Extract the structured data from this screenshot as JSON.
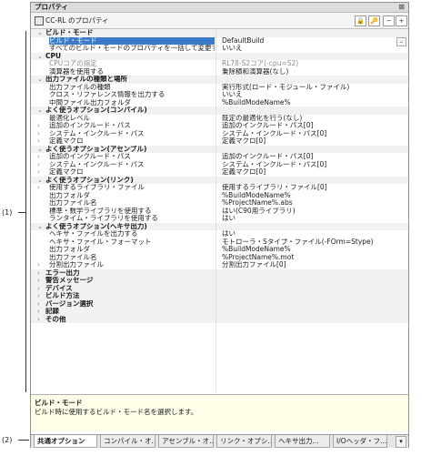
{
  "window": {
    "title": "プロパティ",
    "close_glyph": "⊠"
  },
  "toolbar": {
    "object_name": "CC-RL のプロパティ",
    "buttons": [
      "🔒",
      "🔑",
      "−",
      "+"
    ]
  },
  "rows": [
    {
      "type": "cat",
      "name": "ビルド・モード",
      "exp": "⌄"
    },
    {
      "type": "sel",
      "name": "ビルド・モード",
      "value": "DefaultBuild"
    },
    {
      "type": "prop",
      "name": "すべてのビルド・モードのプロパティを一括して変更する",
      "value": "いいえ"
    },
    {
      "type": "cat",
      "name": "CPU",
      "exp": "⌄"
    },
    {
      "type": "dim",
      "name": "CPUコアの指定",
      "value": "RL78-S2コア(-cpu=S2)"
    },
    {
      "type": "prop",
      "name": "演算器を使用する",
      "value": "乗除積和演算器(なし)"
    },
    {
      "type": "cat",
      "name": "出力ファイルの種類と場所",
      "exp": "⌄"
    },
    {
      "type": "prop",
      "name": "出力ファイルの種類",
      "value": "実行形式(ロード・モジュール・ファイル)"
    },
    {
      "type": "prop",
      "name": "クロス・リファレンス情報を出力する",
      "value": "いいえ"
    },
    {
      "type": "prop",
      "name": "中間ファイル出力フォルダ",
      "value": "%BuildModeName%"
    },
    {
      "type": "cat",
      "name": "よく使うオプション(コンパイル)",
      "exp": "⌄"
    },
    {
      "type": "prop",
      "name": "最適化レベル",
      "value": "既定の最適化を行う(なし)"
    },
    {
      "type": "exp",
      "name": "追加のインクルード・パス",
      "value": "追加のインクルード・パス[0]",
      "exp": "›"
    },
    {
      "type": "exp",
      "name": "システム・インクルード・パス",
      "value": "システム・インクルード・パス[0]",
      "exp": "›"
    },
    {
      "type": "exp",
      "name": "定義マクロ",
      "value": "定義マクロ[0]",
      "exp": "›"
    },
    {
      "type": "cat",
      "name": "よく使うオプション(アセンブル)",
      "exp": "⌄"
    },
    {
      "type": "exp",
      "name": "追加のインクルード・パス",
      "value": "追加のインクルード・パス[0]",
      "exp": "›"
    },
    {
      "type": "exp",
      "name": "システム・インクルード・パス",
      "value": "システム・インクルード・パス[0]",
      "exp": "›"
    },
    {
      "type": "exp",
      "name": "定義マクロ",
      "value": "定義マクロ[0]",
      "exp": "›"
    },
    {
      "type": "cat",
      "name": "よく使うオプション(リンク)",
      "exp": "⌄"
    },
    {
      "type": "exp",
      "name": "使用するライブラリ・ファイル",
      "value": "使用するライブラリ・ファイル[0]",
      "exp": "›"
    },
    {
      "type": "prop",
      "name": "出力フォルダ",
      "value": "%BuildModeName%"
    },
    {
      "type": "prop",
      "name": "出力ファイル名",
      "value": "%ProjectName%.abs"
    },
    {
      "type": "prop",
      "name": "標準・数学ライブラリを使用する",
      "value": "はい(C90用ライブラリ)"
    },
    {
      "type": "prop",
      "name": "ランタイム・ライブラリを使用する",
      "value": "はい"
    },
    {
      "type": "cat",
      "name": "よく使うオプション(ヘキサ出力)",
      "exp": "⌄"
    },
    {
      "type": "prop",
      "name": "ヘキサ・ファイルを出力する",
      "value": "はい"
    },
    {
      "type": "prop",
      "name": "ヘキサ・ファイル・フォーマット",
      "value": "モトローラ・Sタイプ・ファイル(-FOrm=Stype)"
    },
    {
      "type": "prop",
      "name": "出力フォルダ",
      "value": "%BuildModeName%"
    },
    {
      "type": "prop",
      "name": "出力ファイル名",
      "value": "%ProjectName%.mot"
    },
    {
      "type": "exp",
      "name": "分割出力ファイル",
      "value": "分割出力ファイル[0]",
      "exp": "›"
    },
    {
      "type": "cat",
      "name": "エラー出力",
      "exp": "›"
    },
    {
      "type": "cat",
      "name": "警告メッセージ",
      "exp": "›"
    },
    {
      "type": "cat",
      "name": "デバイス",
      "exp": "›"
    },
    {
      "type": "cat",
      "name": "ビルド方法",
      "exp": "›"
    },
    {
      "type": "cat",
      "name": "バージョン選択",
      "exp": "›"
    },
    {
      "type": "cat",
      "name": "記録",
      "exp": "›"
    },
    {
      "type": "cat",
      "name": "その他",
      "exp": "›"
    }
  ],
  "description": {
    "heading": "ビルド・モード",
    "body": "ビルド時に使用するビルド・モード名を選択します。"
  },
  "tabs": [
    "共通オプション",
    "コンパイル・オ...",
    "アセンブル・オ...",
    "リンク・オプシ...",
    "ヘキサ出力...",
    "I/Oヘッダ・フ..."
  ],
  "tabs_more": "▾",
  "callouts": {
    "one": "(1)",
    "two": "(2)"
  }
}
